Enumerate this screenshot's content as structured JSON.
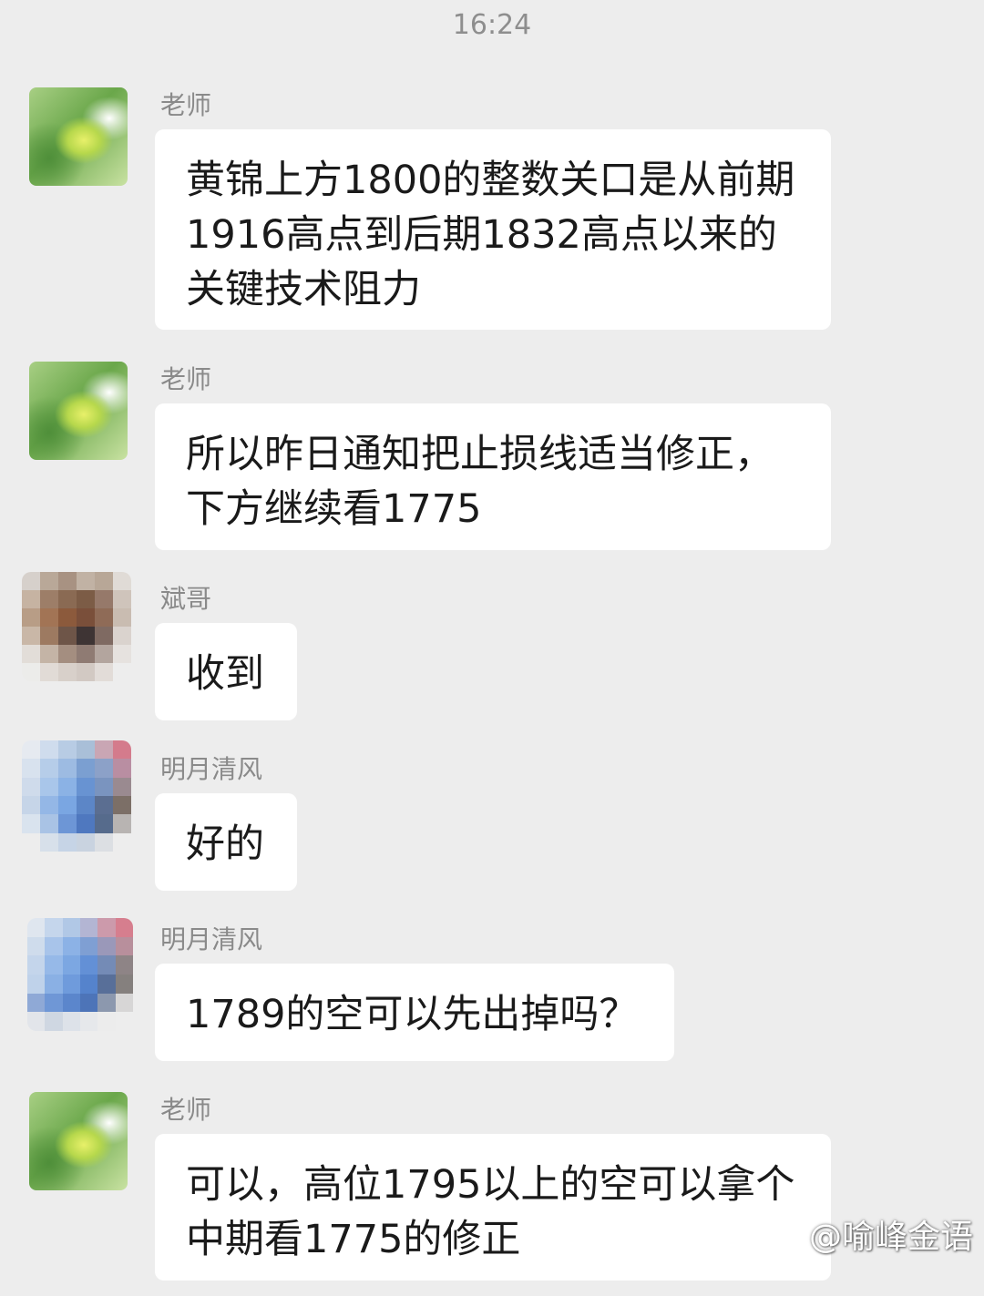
{
  "timestamp": "16:24",
  "messages": [
    {
      "sender": "老师",
      "text": "黄锦上方1800的整数关口是从前期1916高点到后期1832高点以来的关键技术阻力",
      "avatar": "leaf-avatar"
    },
    {
      "sender": "老师",
      "text": "所以昨日通知把止损线适当修正，下方继续看1775",
      "avatar": "leaf-avatar"
    },
    {
      "sender": "斌哥",
      "text": "收到",
      "avatar": "pixelated-avatar"
    },
    {
      "sender": "明月清风",
      "text": "好的",
      "avatar": "pixelated-avatar"
    },
    {
      "sender": "明月清风",
      "text": "1789的空可以先出掉吗？",
      "avatar": "pixelated-avatar"
    },
    {
      "sender": "老师",
      "text": "可以，高位1795以上的空可以拿个中期看1775的修正",
      "avatar": "leaf-avatar"
    }
  ],
  "watermark": "@喻峰金语",
  "colors": {
    "background": "#ededed",
    "bubble": "#ffffff",
    "name": "#8a8a8a",
    "timestamp": "#8e8e8e"
  }
}
